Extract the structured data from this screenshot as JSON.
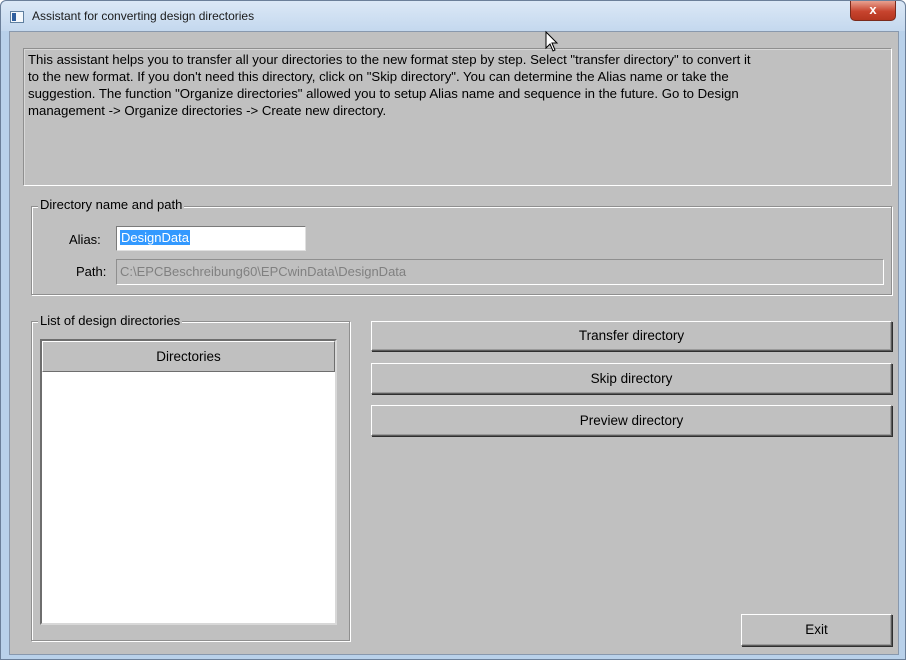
{
  "window": {
    "title": "Assistant for converting design directories",
    "close_glyph": "x"
  },
  "info": {
    "lines": [
      "This assistant helps you to transfer all your directories to the new format step by step. Select \"transfer directory\" to convert it",
      "to the new format. If you don't need this directory, click on \"Skip directory\". You can determine the Alias name or take the",
      "suggestion. The function \"Organize directories\" allowed you to setup Alias name and sequence in the future. Go to Design",
      "management -> Organize directories -> Create new directory."
    ]
  },
  "directory_group": {
    "legend": "Directory name and path",
    "alias_label": "Alias:",
    "alias_value": "DesignData",
    "path_label": "Path:",
    "path_value": "C:\\EPCBeschreibung60\\EPCwinData\\DesignData"
  },
  "list_group": {
    "legend": "List of design directories",
    "column_header": "Directories",
    "items": []
  },
  "actions": {
    "transfer": "Transfer directory",
    "skip": "Skip directory",
    "preview": "Preview directory",
    "exit": "Exit"
  },
  "icons": [
    "app-window-icon",
    "close-icon",
    "mouse-pointer-icon"
  ]
}
